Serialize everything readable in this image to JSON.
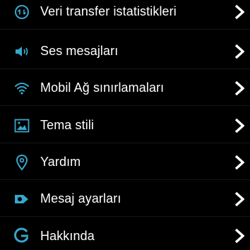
{
  "accent_color": "#37a7cc",
  "items": [
    {
      "label": "Veri transfer istatistikleri",
      "icon": "data-transfer-icon"
    },
    {
      "label": "Ses mesajları",
      "icon": "speaker-icon"
    },
    {
      "label": "Mobil Ağ sınırlamaları",
      "icon": "wifi-icon"
    },
    {
      "label": "Tema stili",
      "icon": "image-icon"
    },
    {
      "label": "Yardım",
      "icon": "location-pin-icon"
    },
    {
      "label": "Mesaj ayarları",
      "icon": "message-tag-icon"
    },
    {
      "label": "Hakkında",
      "icon": "info-g-icon"
    }
  ]
}
